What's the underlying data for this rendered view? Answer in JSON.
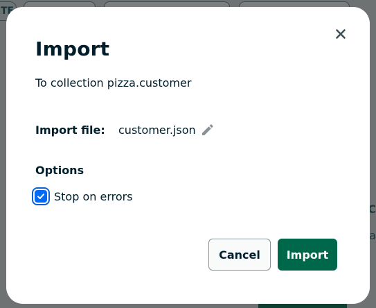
{
  "background": {
    "first_pill_text": "TE",
    "edge_texts": [
      "C",
      "ra"
    ]
  },
  "modal": {
    "title": "Import",
    "subtitle": "To collection pizza.customer",
    "close_icon": "close-icon",
    "import_file": {
      "label": "Import file:",
      "file_name": "customer.json",
      "edit_icon": "pencil-icon"
    },
    "options": {
      "heading": "Options",
      "stop_on_errors": {
        "label": "Stop on errors",
        "checked": true
      }
    },
    "buttons": {
      "cancel_label": "Cancel",
      "import_label": "Import"
    }
  },
  "colors": {
    "primary_green": "#00684a",
    "checkbox_blue": "#016bf8",
    "text_dark": "#001e2b"
  }
}
